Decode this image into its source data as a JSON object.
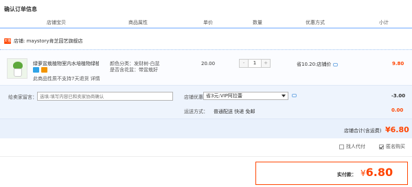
{
  "page": {
    "title": "确认订单信息"
  },
  "columns": [
    "店铺宝贝",
    "商品属性",
    "单价",
    "数量",
    "优惠方式",
    "小计"
  ],
  "shop": {
    "icon_text": "天猫",
    "label": "店铺: maystory肯芝园艺旗舰店"
  },
  "item": {
    "name": "绿萝盆栽植物室内水培植物绿植…",
    "attr_color": "颜色分类：发财树-白盆",
    "attr_flower": "是否含花盆：带盆栽好",
    "notice": "此商品性质不支持7天退货 详情",
    "price": "20.00",
    "qty": "1",
    "qty_minus": "-",
    "qty_plus": "+",
    "discount": "省10.20:店铺价",
    "subtotal": "9.80"
  },
  "options": {
    "message_label": "给卖家留言：",
    "message_placeholder": "选填:填写内容已和卖家协商确认",
    "shop_discount_label": "店铺优惠：",
    "shop_discount_value": "省3元:VIP阿拉蕾",
    "shop_discount_amount": "-3.00",
    "shipping_label": "运送方式：",
    "shipping_value": "普通配送 快递 免邮",
    "shipping_amount": "0.00"
  },
  "shop_total": {
    "label": "店铺合计(含运费)",
    "value": "¥6.80"
  },
  "checks": {
    "agent_pay": "找人代付",
    "anonymous": "匿名购买"
  },
  "pay": {
    "label": "实付款：",
    "currency": "¥",
    "amount": "6.80"
  },
  "colors": {
    "accent": "#ff4400",
    "blue_line": "#b2d1ff",
    "option_bg": "#eef4fd"
  }
}
